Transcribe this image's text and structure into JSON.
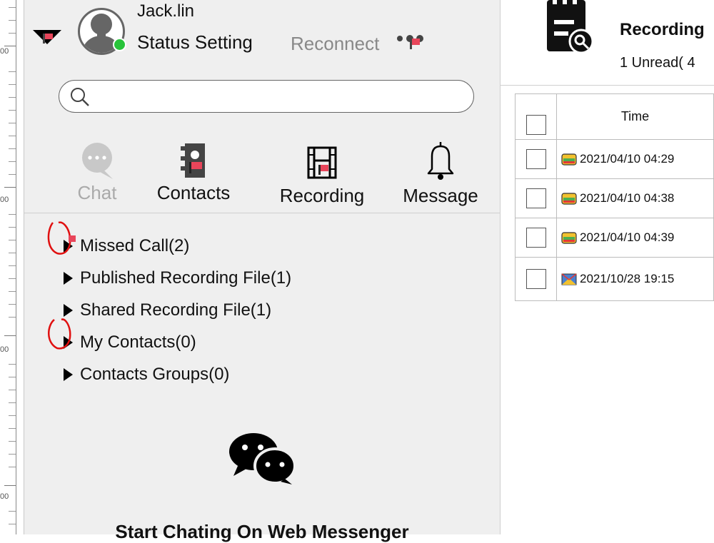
{
  "user": {
    "name": "Jack.lin",
    "status_setting": "Status Setting",
    "reconnect": "Reconnect"
  },
  "search": {
    "placeholder": "",
    "value": ""
  },
  "nav": [
    {
      "label": "Chat",
      "icon": "chat-bubble-icon",
      "active": false
    },
    {
      "label": "Contacts",
      "icon": "contacts-book-icon",
      "active": true
    },
    {
      "label": "Recording",
      "icon": "film-icon",
      "active": true
    },
    {
      "label": "Message",
      "icon": "bell-icon",
      "active": true
    }
  ],
  "tree": [
    {
      "label": "Missed Call(2)"
    },
    {
      "label": "Published Recording File(1)"
    },
    {
      "label": "Shared Recording File(1)"
    },
    {
      "label": "My Contacts(0)"
    },
    {
      "label": "Contacts Groups(0)"
    }
  ],
  "footer": {
    "start_chat": "Start Chating On Web Messenger"
  },
  "ruler": {
    "labels": [
      "00",
      "00",
      "00",
      "00"
    ]
  },
  "recording_panel": {
    "title": "Recording",
    "unread": "1 Unread( 4",
    "table": {
      "columns": [
        "Time"
      ],
      "rows": [
        {
          "time": "2021/04/10 04:29",
          "icon": "recording-file-icon"
        },
        {
          "time": "2021/04/10 04:38",
          "icon": "recording-file-icon"
        },
        {
          "time": "2021/04/10 04:39",
          "icon": "recording-file-icon"
        },
        {
          "time": "2021/10/28 19:15",
          "icon": "mail-file-icon"
        }
      ]
    }
  },
  "colors": {
    "online": "#28c33a",
    "accent_red": "#e8455a",
    "annotation_red": "#e01010",
    "panel_bg": "#efefef"
  }
}
